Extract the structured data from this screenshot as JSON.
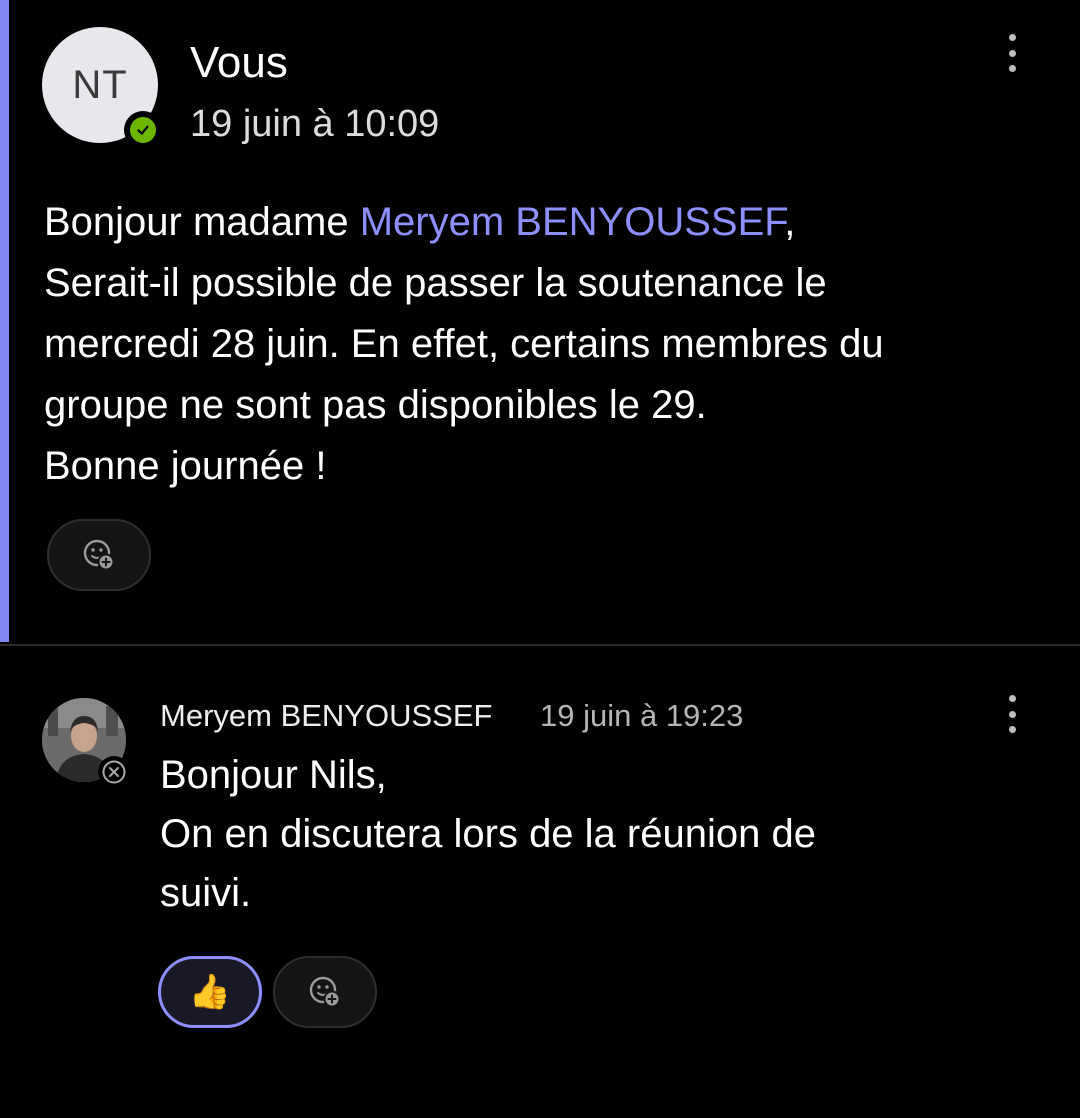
{
  "post": {
    "author": "Vous",
    "avatar_initials": "NT",
    "timestamp": "19 juin à 10:09",
    "status": "available",
    "message": {
      "line1_prefix": "Bonjour madame ",
      "mention": "Meryem BENYOUSSEF",
      "line1_suffix": ",",
      "line2": "Serait-il possible de passer la soutenance le",
      "line3": "mercredi 28 juin. En effet, certains membres du",
      "line4": "groupe ne sont pas disponibles le 29.",
      "line5": "Bonne journée !"
    },
    "reactions": []
  },
  "reply": {
    "author": "Meryem BENYOUSSEF",
    "timestamp": "19 juin à 19:23",
    "status": "offline",
    "message": {
      "line1": "Bonjour Nils,",
      "line2": "On en discutera lors de la réunion de",
      "line3": "suivi."
    },
    "reactions": [
      {
        "emoji": "👍",
        "selected": true
      }
    ]
  },
  "colors": {
    "accent": "#7f85f5",
    "mention": "#8f90ff",
    "status_available": "#6bb700",
    "background": "#000000"
  },
  "icons": {
    "more_options": "more-vertical-icon",
    "add_reaction": "emoji-add-icon",
    "status_available": "check-circle-icon",
    "status_offline": "x-circle-icon"
  }
}
